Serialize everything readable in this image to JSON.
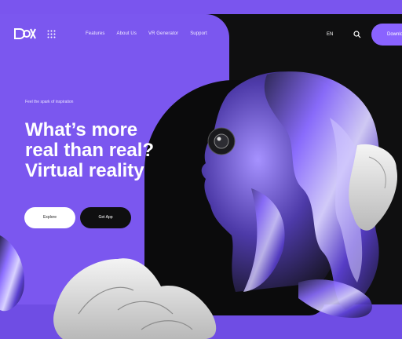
{
  "header": {
    "nav": [
      "Features",
      "About Us",
      "VR Generator",
      "Support"
    ],
    "lang": "EN",
    "cta": "Downlo"
  },
  "hero": {
    "tagline": "Feel the spark of inspiration",
    "headline": [
      "What’s more",
      "real than real?",
      "Virtual reality"
    ],
    "primary_button": "Explore",
    "secondary_button": "Get App"
  },
  "colors": {
    "accent": "#7b57ef",
    "dark": "#0f0f10",
    "button_light": "#ffffff"
  },
  "icons": {
    "logo": "brand-logo",
    "grid": "apps-grid-icon",
    "search": "search-icon",
    "art": "chrome-head-illustration"
  }
}
